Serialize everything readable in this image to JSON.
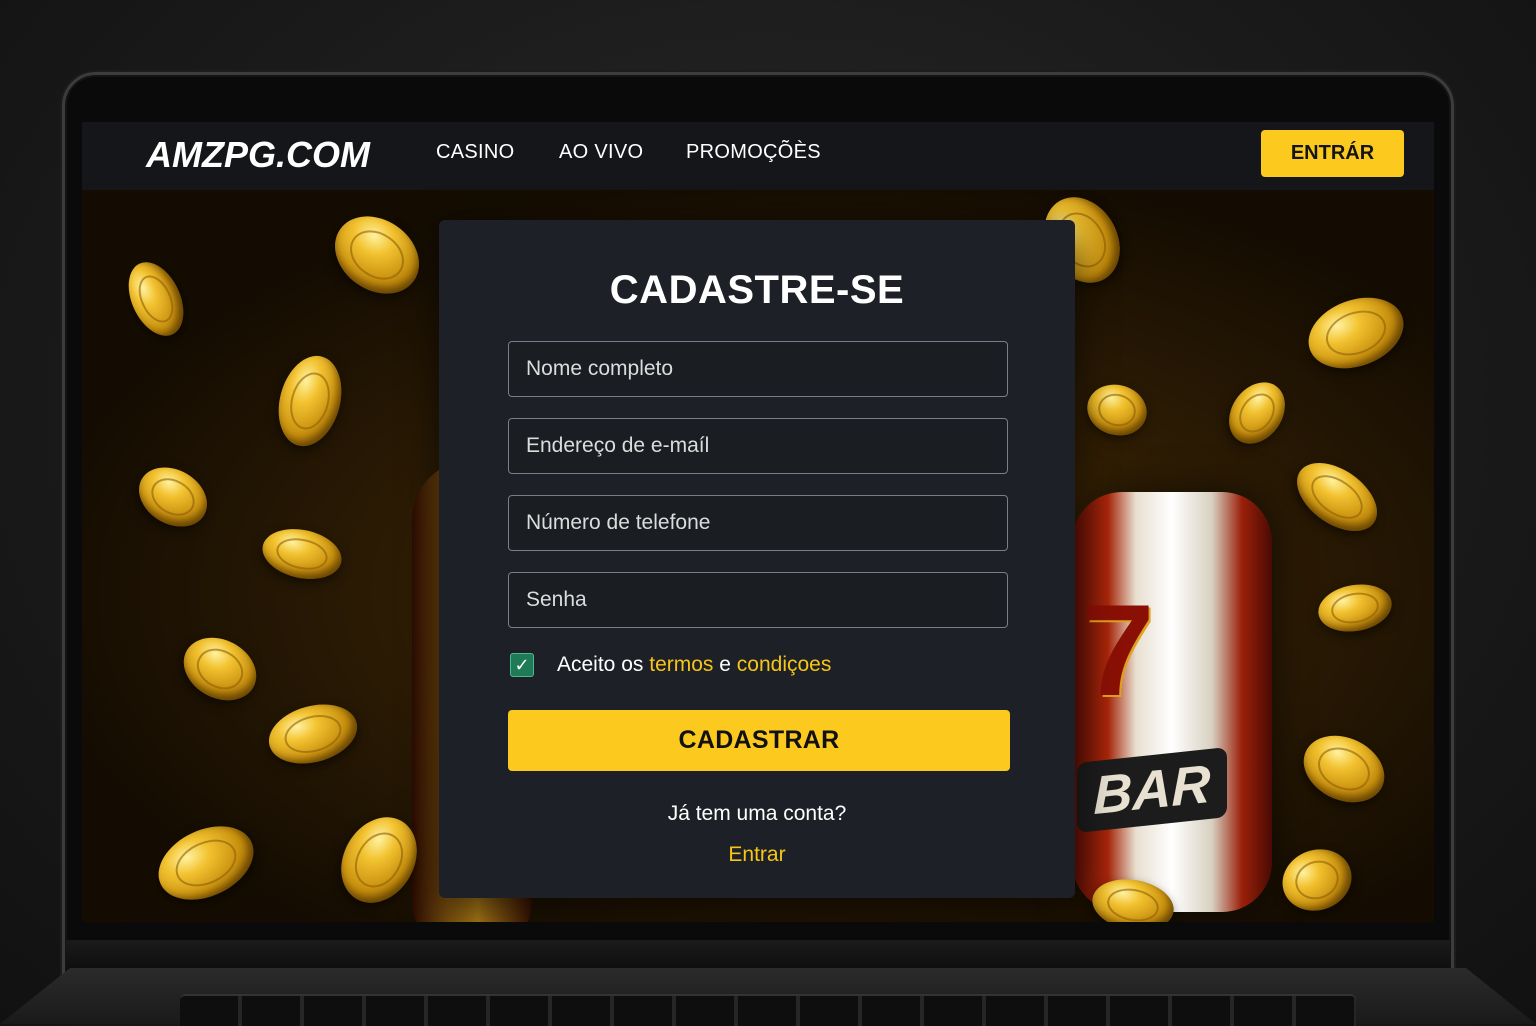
{
  "navbar": {
    "logo": "AMZPG.COM",
    "links": [
      {
        "label": "CASINO"
      },
      {
        "label": "AO VIVO"
      },
      {
        "label": "PROMOÇÕÈS"
      }
    ],
    "login_button": "ENTRÁR"
  },
  "hero": {
    "slot_reel_text": "BAR",
    "slot_reel_symbol": "7"
  },
  "form": {
    "title": "CADASTRE-SE",
    "fields": [
      {
        "placeholder": "Nome completo",
        "value": ""
      },
      {
        "placeholder": "Endereço de e-maíl",
        "value": ""
      },
      {
        "placeholder": "Número de telefone",
        "value": ""
      },
      {
        "placeholder": "Senha",
        "value": ""
      }
    ],
    "terms": {
      "checked": true,
      "prefix": "Aceito os",
      "terms_link": "termos",
      "connector": "e",
      "conditions_link": "condiçoes"
    },
    "submit_label": "CADASTRAR",
    "have_account": "Já tem uma conta?",
    "login_link": "Entrar"
  },
  "colors": {
    "accent": "#fcc91e",
    "link": "#f5c518",
    "card": "#1d2026",
    "navbar": "#141619",
    "checkbox": "#1e7a57"
  }
}
